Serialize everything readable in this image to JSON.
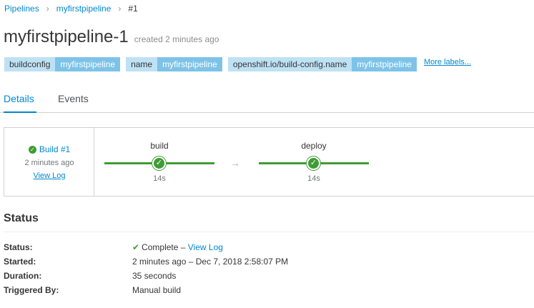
{
  "breadcrumb": {
    "items": [
      "Pipelines",
      "myfirstpipeline"
    ],
    "current": "#1"
  },
  "header": {
    "title": "myfirstpipeline-1",
    "created": "created 2 minutes ago"
  },
  "labels": {
    "pairs": [
      {
        "key": "buildconfig",
        "value": "myfirstpipeline"
      },
      {
        "key": "name",
        "value": "myfirstpipeline"
      },
      {
        "key": "openshift.io/build-config.name",
        "value": "myfirstpipeline"
      }
    ],
    "more": "More labels..."
  },
  "tabs": [
    "Details",
    "Events"
  ],
  "pipeline": {
    "build_label": "Build #1",
    "build_time": "2 minutes ago",
    "view_log": "View Log",
    "stages": [
      {
        "name": "build",
        "duration": "14s"
      },
      {
        "name": "deploy",
        "duration": "14s"
      }
    ],
    "arrow": "→",
    "status_color": "#3f9c35"
  },
  "status": {
    "heading": "Status",
    "fields": [
      {
        "label": "Status:",
        "value": "Complete",
        "sep": " – ",
        "link": "View Log"
      },
      {
        "label": "Started:",
        "value": "2 minutes ago – Dec 7, 2018 2:58:07 PM"
      },
      {
        "label": "Duration:",
        "value": "35 seconds"
      },
      {
        "label": "Triggered By:",
        "value": "Manual build"
      }
    ]
  },
  "icons": {
    "check": "check-icon",
    "complete": "checkmark-icon"
  },
  "colors": {
    "accent": "#0088ce",
    "success": "#3f9c35",
    "label_key_bg": "#bee1f4",
    "label_value_bg": "#7dc3e8"
  }
}
